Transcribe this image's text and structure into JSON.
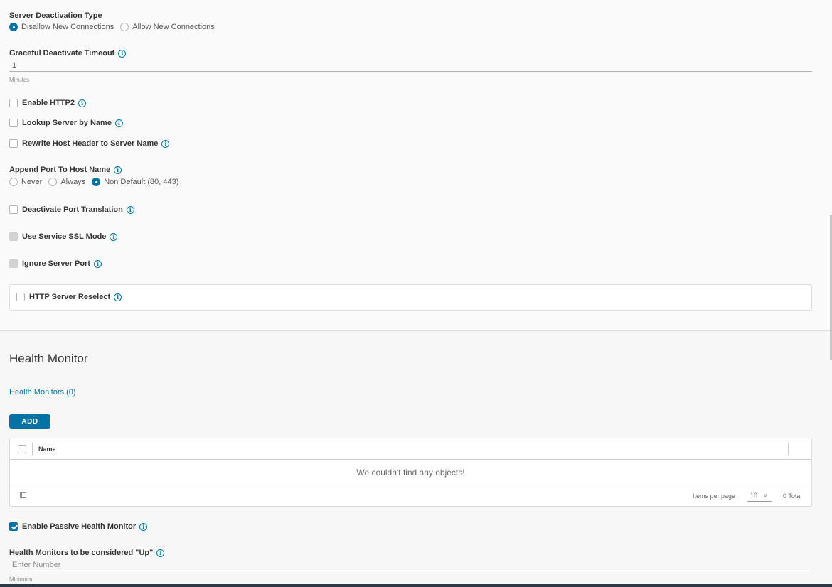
{
  "deactivation": {
    "label": "Server Deactivation Type",
    "options": [
      {
        "label": "Disallow New Connections",
        "checked": true
      },
      {
        "label": "Allow New Connections",
        "checked": false
      }
    ]
  },
  "timeout": {
    "label": "Graceful Deactivate Timeout",
    "value": "1",
    "helper": "Minutes"
  },
  "checkboxes": {
    "http2": "Enable HTTP2",
    "lookup": "Lookup Server by Name",
    "rewrite": "Rewrite Host Header to Server Name"
  },
  "append_port": {
    "label": "Append Port To Host Name",
    "options": [
      {
        "label": "Never",
        "checked": false
      },
      {
        "label": "Always",
        "checked": false
      },
      {
        "label": "Non Default (80, 443)",
        "checked": true
      }
    ]
  },
  "more_checkboxes": {
    "port_translation": "Deactivate Port Translation",
    "service_ssl": "Use Service SSL Mode",
    "ignore_port": "Ignore Server Port",
    "reselect": "HTTP Server Reselect"
  },
  "health": {
    "title": "Health Monitor",
    "link": "Health Monitors (0)",
    "add_label": "ADD",
    "grid": {
      "column_name": "Name",
      "empty": "We couldn't find any objects!",
      "items_per_page_label": "Items per page",
      "items_per_page_value": "10",
      "total": "0 Total"
    },
    "passive_label": "Enable Passive Health Monitor",
    "up_label": "Health Monitors to be considered \"Up\"",
    "up_placeholder": "Enter Number",
    "up_helper": "Minimum"
  },
  "icons": {
    "info": "i"
  }
}
